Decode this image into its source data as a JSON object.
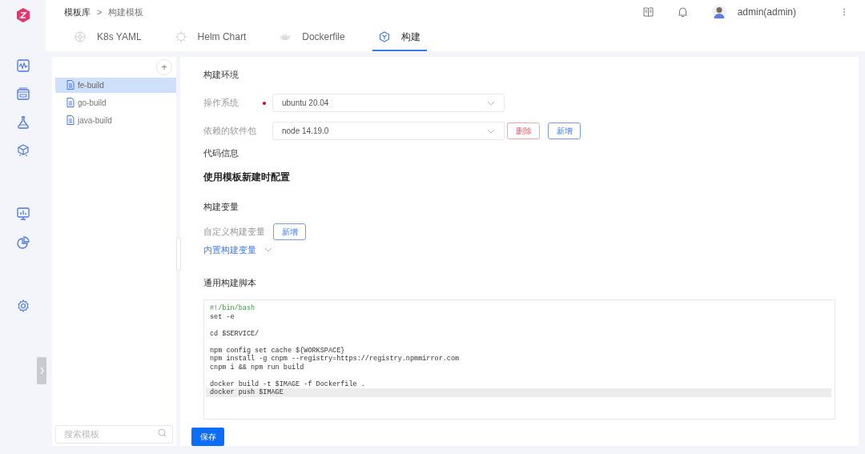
{
  "breadcrumb": [
    "模板库",
    ">",
    "构建模板"
  ],
  "header": {
    "user": "admin(admin)"
  },
  "tabs": [
    {
      "label": "K8s YAML",
      "selected": false,
      "kind": "k8s"
    },
    {
      "label": "Helm Chart",
      "selected": false,
      "kind": "helm"
    },
    {
      "label": "Dockerfile",
      "selected": false,
      "kind": "docker"
    },
    {
      "label": "构建",
      "selected": true,
      "kind": "build"
    }
  ],
  "templates": {
    "add": "+",
    "items": [
      {
        "label": "fe-build",
        "selected": true
      },
      {
        "label": "go-build",
        "selected": false
      },
      {
        "label": "java-build",
        "selected": false
      }
    ],
    "search": {
      "placeholder": "搜索模板"
    }
  },
  "form": {
    "env_title": "构建环境",
    "os": {
      "label": "操作系统",
      "value": "ubuntu 20.04"
    },
    "packages": {
      "label": "依赖的软件包",
      "value": "node 14.19.0",
      "delete": "删除",
      "add": "新增"
    },
    "code_title": "代码信息",
    "code_note": "使用模板新建时配置",
    "vars_title": "构建变量",
    "custom_vars": {
      "label": "自定义构建变量",
      "add": "新增"
    },
    "builtin_vars": {
      "label": "内置构建变量",
      "expanded": false
    },
    "script_title": "通用构建脚本",
    "script": [
      {
        "text": "#!/bin/bash",
        "kind": "comment",
        "active": false
      },
      {
        "text": "set -e",
        "kind": "code",
        "active": false
      },
      {
        "kind": "blank",
        "active": false
      },
      {
        "text": "cd $SERVICE/",
        "kind": "code",
        "active": false
      },
      {
        "kind": "blank",
        "active": false
      },
      {
        "text": "npm config set cache ${WORKSPACE}",
        "kind": "code",
        "active": false
      },
      {
        "text": "npm install -g cnpm --registry=https://registry.npmmirror.com",
        "kind": "code",
        "active": false
      },
      {
        "text": "cnpm i && npm run build",
        "kind": "code",
        "active": false
      },
      {
        "kind": "blank",
        "active": false
      },
      {
        "text": "docker build -t $IMAGE -f Dockerfile .",
        "kind": "code",
        "active": false
      },
      {
        "text": "docker push $IMAGE",
        "kind": "code",
        "active": true
      }
    ],
    "save": "保存"
  }
}
